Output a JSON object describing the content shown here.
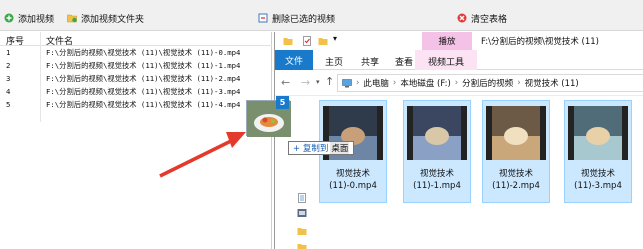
{
  "toolbar": {
    "add_video": "添加视频",
    "add_folder": "添加视频文件夹",
    "delete_selected": "删除已选的视频",
    "clear_list": "清空表格"
  },
  "file_list": {
    "header_num": "序号",
    "header_name": "文件名",
    "rows": [
      {
        "num": "1",
        "name": "F:\\分割后的视频\\视觉技术 (11)\\视觉技术 (11)-0.mp4"
      },
      {
        "num": "2",
        "name": "F:\\分割后的视频\\视觉技术 (11)\\视觉技术 (11)-1.mp4"
      },
      {
        "num": "3",
        "name": "F:\\分割后的视频\\视觉技术 (11)\\视觉技术 (11)-2.mp4"
      },
      {
        "num": "4",
        "name": "F:\\分割后的视频\\视觉技术 (11)\\视觉技术 (11)-3.mp4"
      },
      {
        "num": "5",
        "name": "F:\\分割后的视频\\视觉技术 (11)\\视觉技术 (11)-4.mp4"
      }
    ]
  },
  "explorer": {
    "title_path": "F:\\分割后的视频\\视觉技术 (11)",
    "playback_label": "播放",
    "tabs": [
      "文件",
      "主页",
      "共享",
      "查看",
      "视频工具"
    ],
    "address": [
      "此电脑",
      "本地磁盘 (F:)",
      "分割后的视频",
      "视觉技术 (11)"
    ],
    "nav_partial": "快",
    "thumbnails": [
      {
        "label_line1": "视觉技术",
        "label_line2": "(11)-0.mp4"
      },
      {
        "label_line1": "视觉技术",
        "label_line2": "(11)-1.mp4"
      },
      {
        "label_line1": "视觉技术",
        "label_line2": "(11)-2.mp4"
      },
      {
        "label_line1": "视觉技术",
        "label_line2": "(11)-3.mp4"
      }
    ]
  },
  "drag": {
    "count": "5",
    "tooltip_action": "+ 复制到",
    "tooltip_target": "桌面"
  },
  "colors": {
    "accent_blue": "#1979ca",
    "selection": "#cce8ff",
    "arrow_red": "#e43a2c",
    "video_tools_pink": "#f4c2e6"
  }
}
